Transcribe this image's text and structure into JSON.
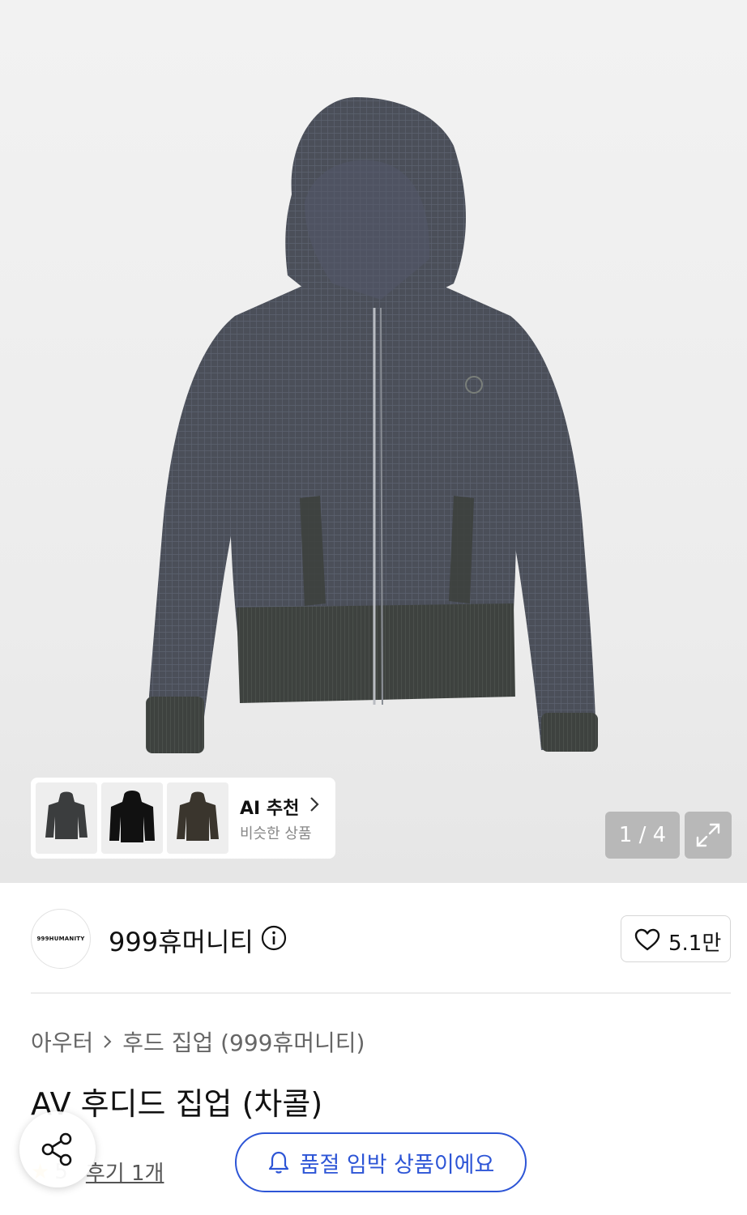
{
  "gallery": {
    "pager": "1 / 4",
    "ai_recommend": {
      "title": "AI 추천",
      "subtitle": "비슷한 상품"
    }
  },
  "brand": {
    "logo_text": "999HUMANITY",
    "name": "999휴머니티",
    "likes": "5.1만"
  },
  "breadcrumb": {
    "category": "아우터",
    "subcategory": "후드 집업 (999휴머니티)"
  },
  "product": {
    "title": "AV 후디드 집업 (차콜)",
    "rating": "5",
    "review_link": "후기 1개"
  },
  "actions": {
    "soldout_notice": "품절 임박 상품이에요"
  },
  "colors": {
    "accent_blue": "#2d55d6",
    "product_charcoal": "#4a4e57"
  }
}
